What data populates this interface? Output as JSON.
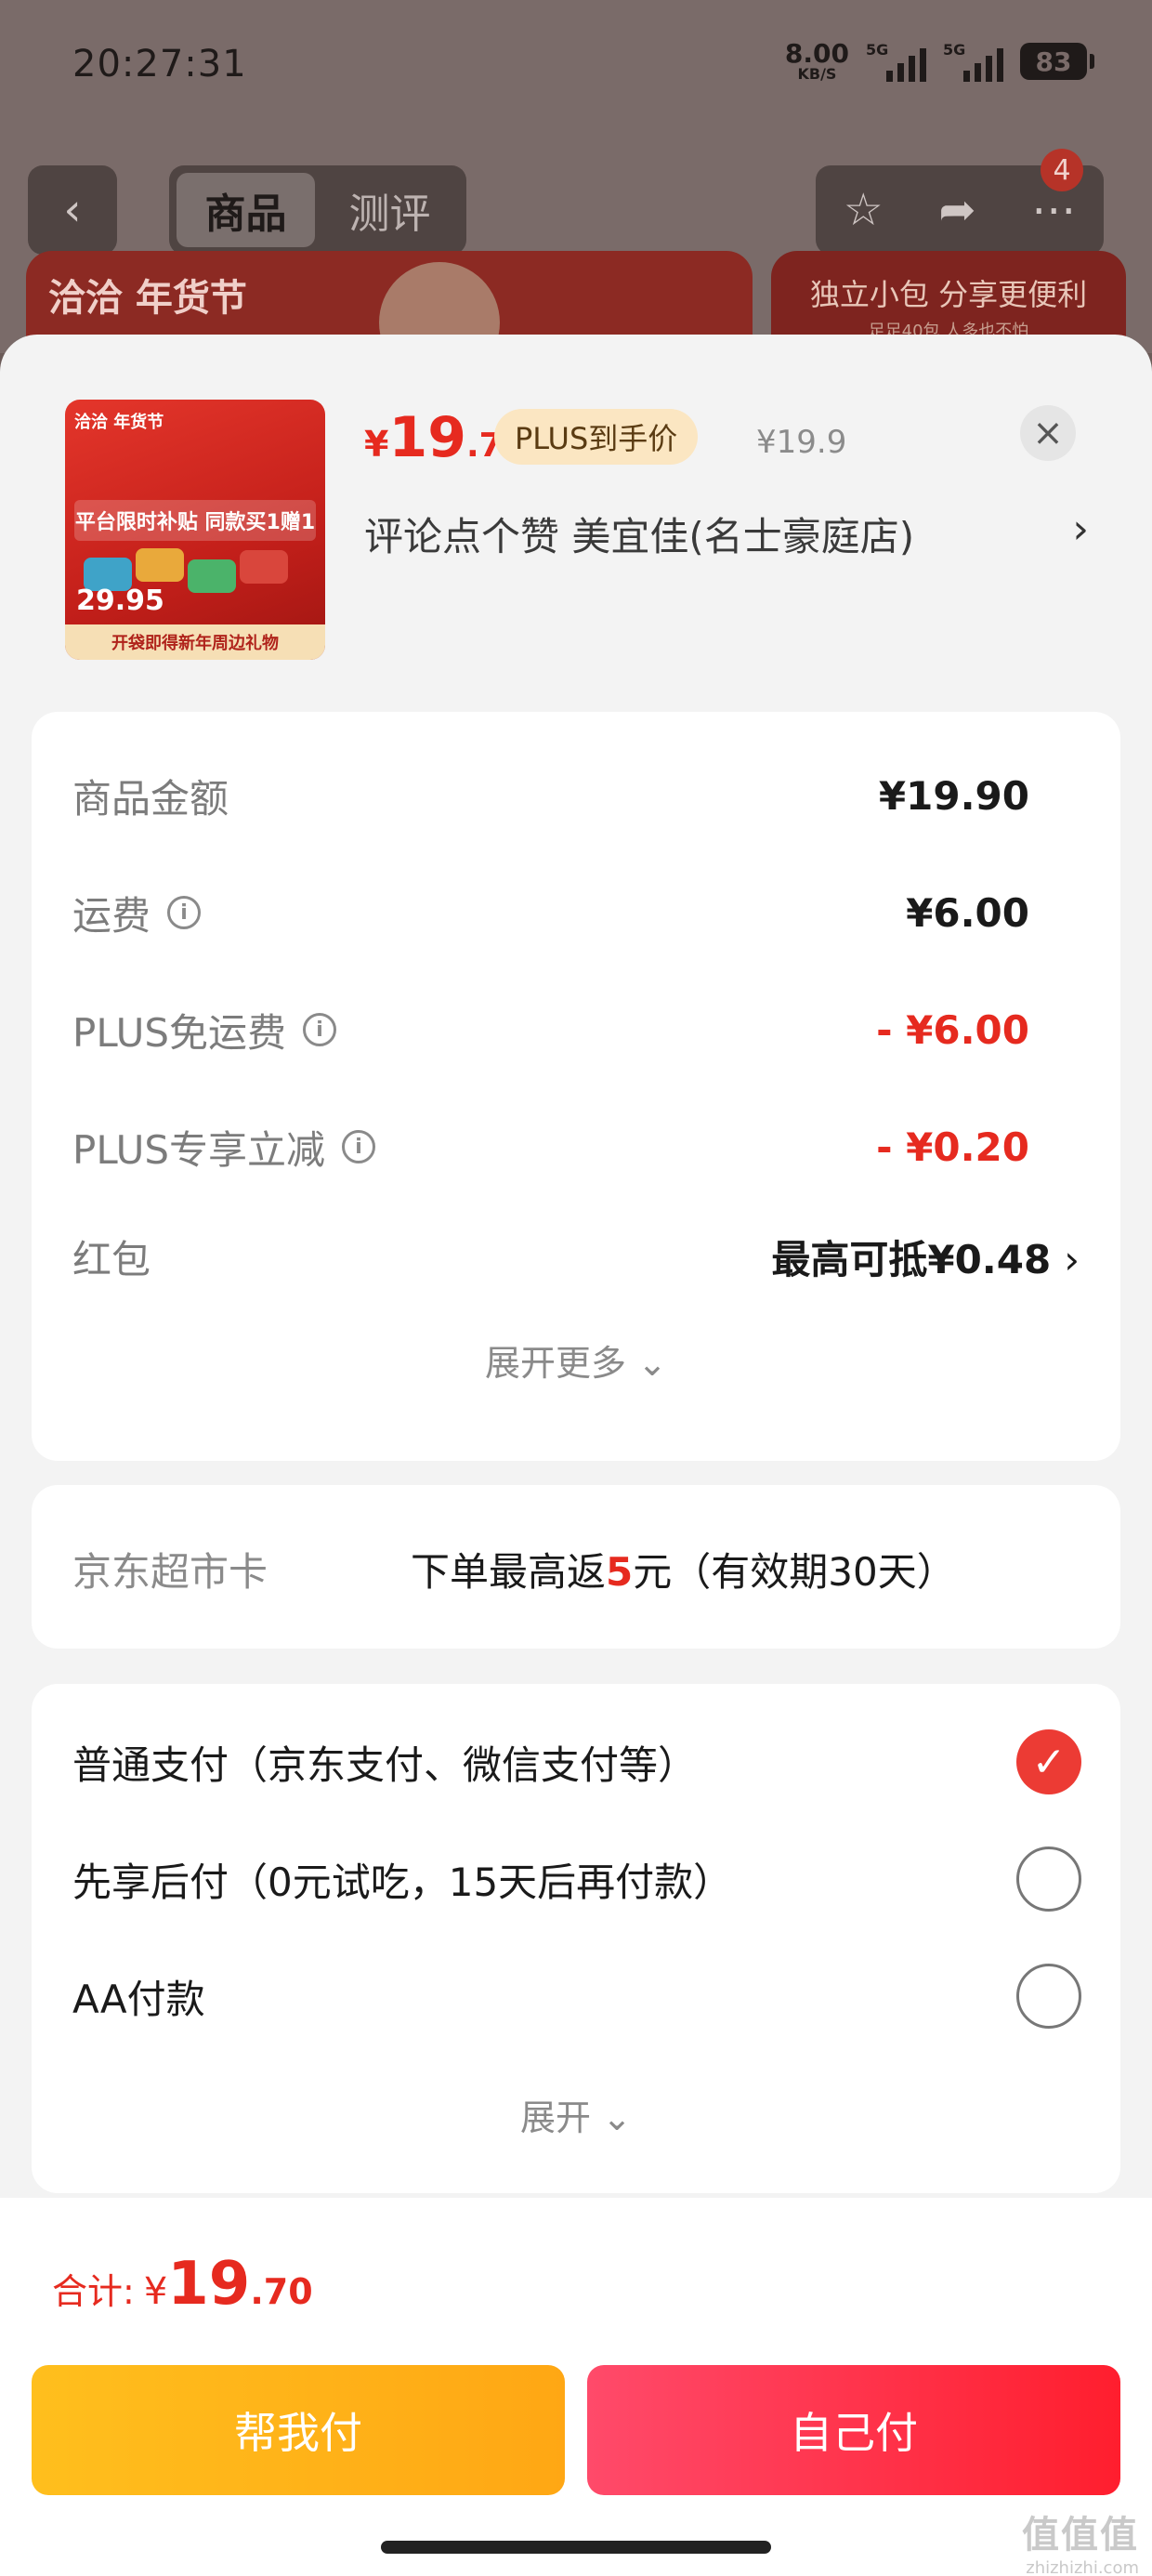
{
  "status_bar": {
    "time": "20:27:31",
    "net_speed": "8.00",
    "net_unit": "KB/S",
    "signal1_label": "5G",
    "signal2_label": "5G",
    "battery": "83"
  },
  "nav": {
    "back_icon": "chevron-left-icon",
    "tabs": [
      {
        "label": "商品",
        "active": true
      },
      {
        "label": "测评",
        "active": false
      }
    ],
    "actions": [
      "star-icon",
      "share-icon",
      "more-icon"
    ],
    "badge": "4"
  },
  "banner": {
    "left_brand": "洽洽 年货节",
    "right_line1": "独立小包 分享更便利",
    "right_line2": "足足40包 人多也不怕"
  },
  "product": {
    "thumb_brand": "洽洽 年货节",
    "thumb_headline": "平台限时补贴 同款买1赠1",
    "thumb_price": "29.95",
    "thumb_footer": "开袋即得新年周边礼物",
    "price_currency": "¥",
    "price_main": "19",
    "price_decimal": ".7",
    "plus_tag": "PLUS到手价",
    "original_price": "¥19.9",
    "store": "评论点个赞  美宜佳(名士豪庭店)"
  },
  "summary": {
    "rows": [
      {
        "label": "商品金额",
        "value": "¥19.90"
      },
      {
        "label": "运费",
        "value": "¥6.00"
      },
      {
        "label": "PLUS免运费",
        "value": "- ¥6.00"
      },
      {
        "label": "PLUS专享立减",
        "value": "- ¥0.20"
      },
      {
        "label": "红包",
        "value": "最高可抵¥0.48"
      }
    ],
    "expand_more": "展开更多"
  },
  "card": {
    "label": "京东超市卡",
    "text_before": "下单最高返",
    "highlight": "5",
    "text_after": "元（有效期30天）"
  },
  "payment": {
    "options": [
      {
        "label": "普通支付（京东支付、微信支付等）",
        "checked": true
      },
      {
        "label": "先享后付（0元试吃，15天后再付款）",
        "checked": false
      },
      {
        "label": "AA付款",
        "checked": false
      }
    ],
    "expand": "展开"
  },
  "footer": {
    "total_label": "合计:",
    "total_currency": "¥",
    "total_main": "19",
    "total_decimal": ".70",
    "help_pay": "帮我付",
    "self_pay": "自己付",
    "watermark": "值值值",
    "watermark_url": "zhizhizhi.com"
  },
  "colors": {
    "accent_red": "#e62a1f",
    "help_button": "#ffb119",
    "self_button": "#ff2a40"
  }
}
